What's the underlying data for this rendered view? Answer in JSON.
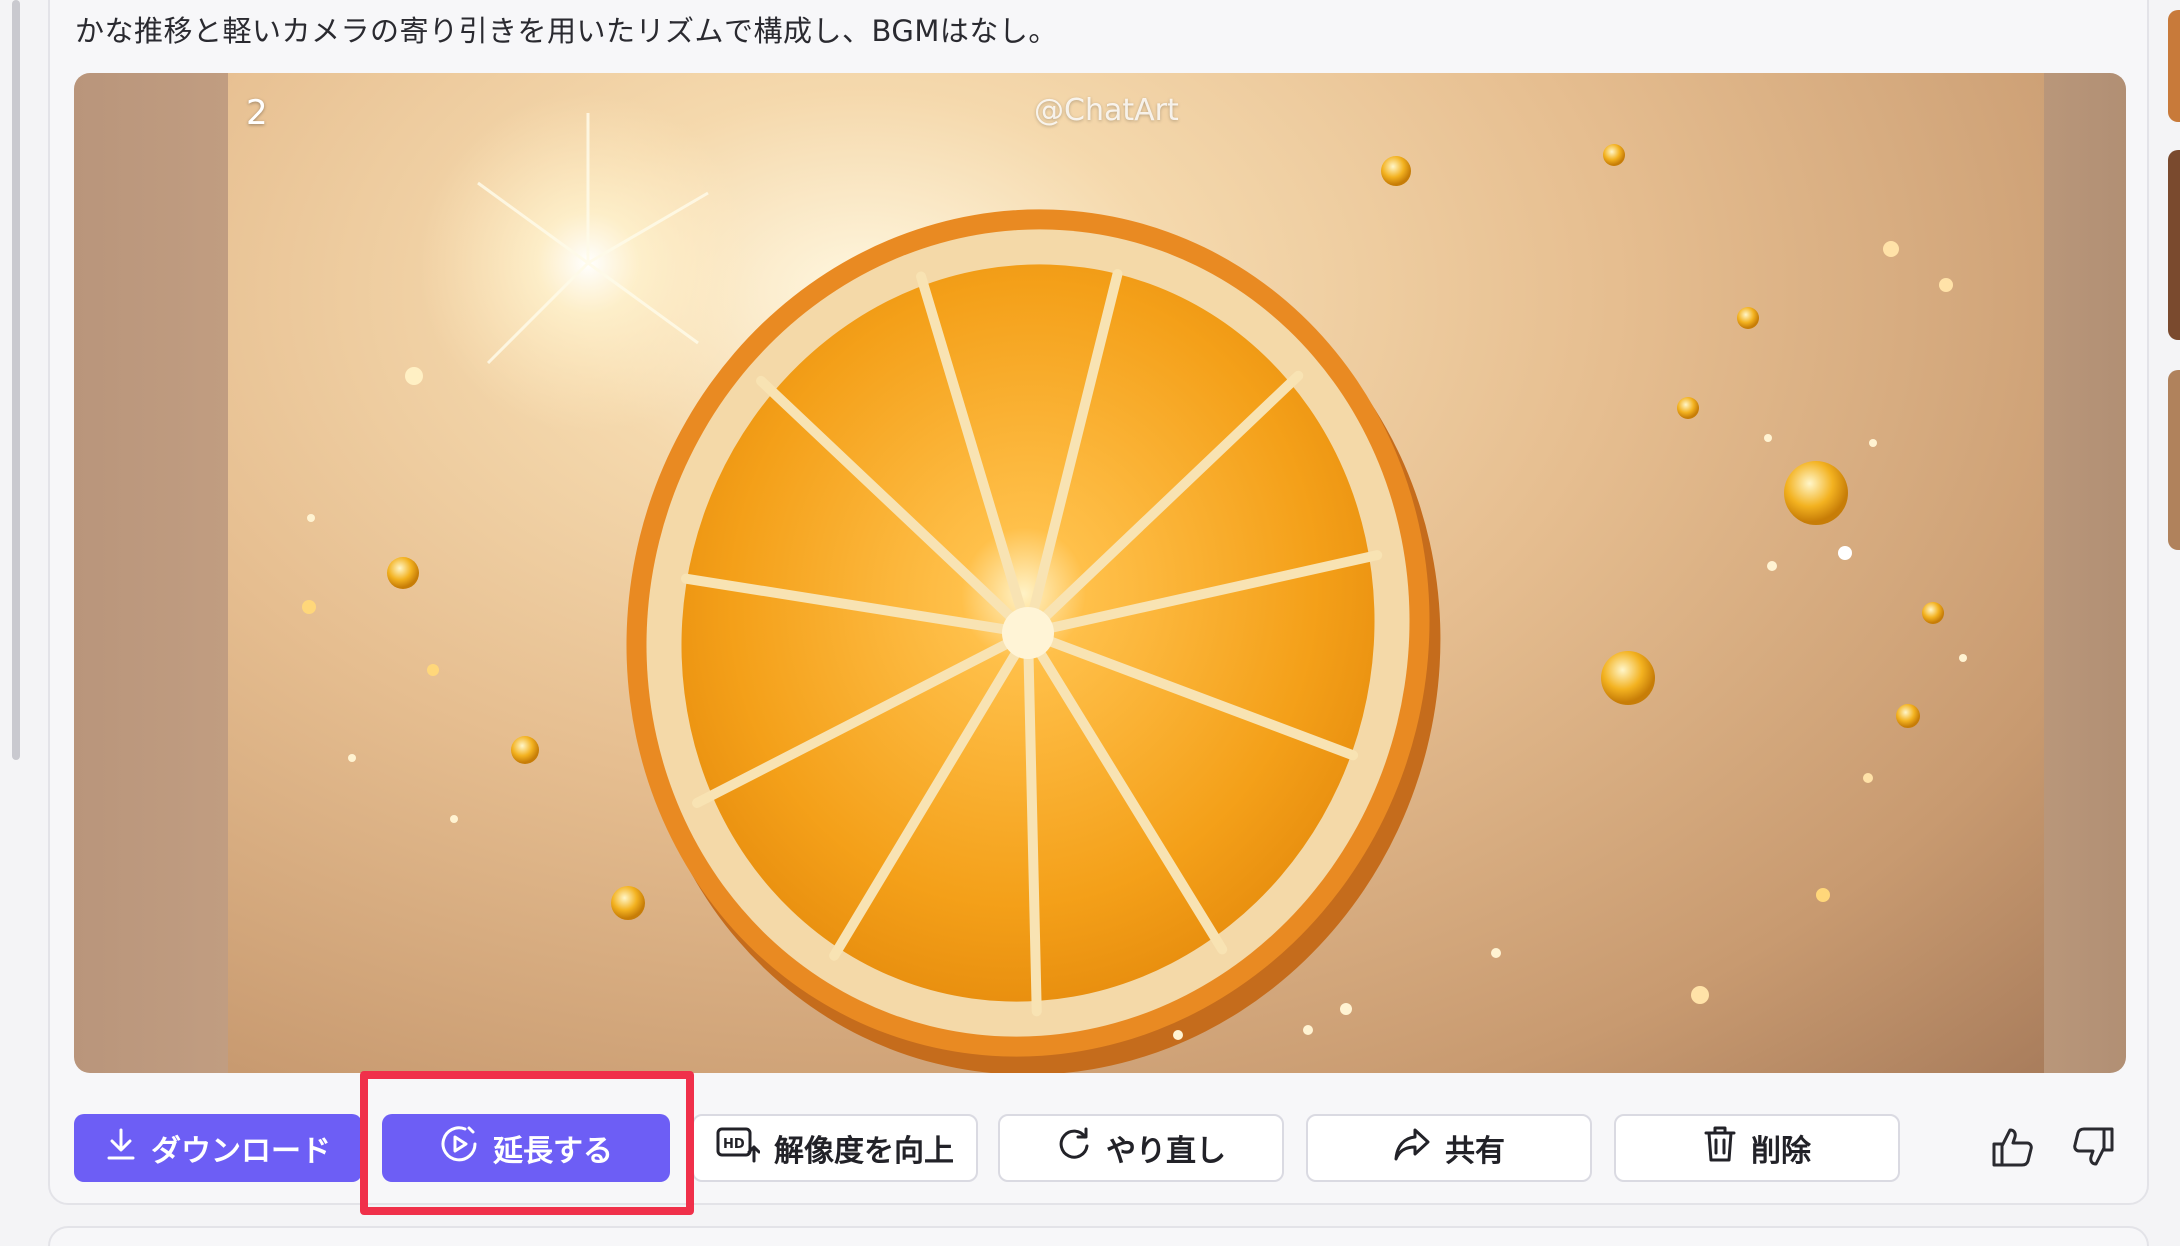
{
  "prompt": {
    "text": "かな推移と軽いカメラの寄り引きを用いたリズムで構成し、BGMはなし。"
  },
  "media": {
    "slide_number": "2",
    "watermark": "@ChatArt"
  },
  "toolbar": {
    "download_label": "ダウンロード",
    "extend_label": "延長する",
    "upscale_label": "解像度を向上",
    "redo_label": "やり直し",
    "share_label": "共有",
    "delete_label": "削除"
  },
  "colors": {
    "primary": "#6d5ef5",
    "highlight": "#f0304a",
    "border": "#dadae2"
  },
  "icons": {
    "download": "download-icon",
    "extend": "video-extend-icon",
    "upscale": "hd-upscale-icon",
    "redo": "redo-icon",
    "share": "share-icon",
    "delete": "trash-icon",
    "like": "thumbs-up-icon",
    "dislike": "thumbs-down-icon"
  }
}
